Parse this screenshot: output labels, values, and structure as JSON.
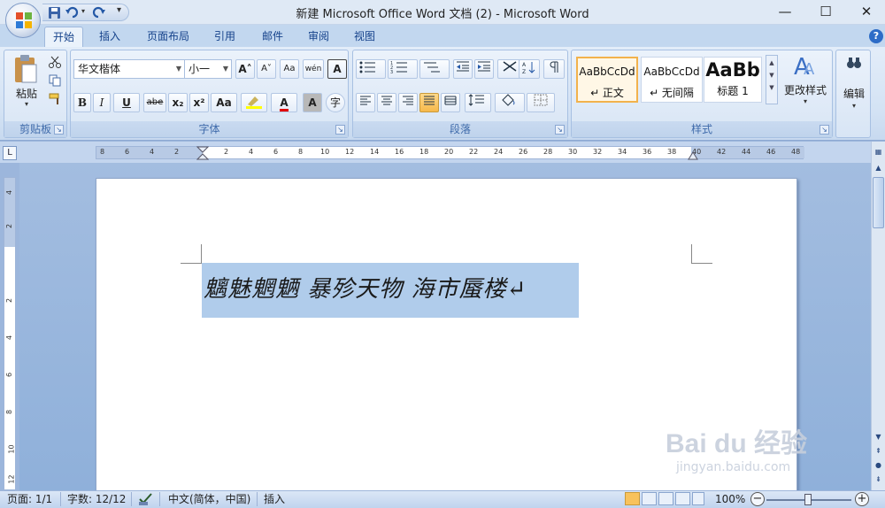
{
  "window": {
    "title": "新建 Microsoft Office Word 文档 (2) - Microsoft Word",
    "minimize": "—",
    "maximize": "☐",
    "close": "✕"
  },
  "quick_access": {
    "icons": [
      "save-icon",
      "undo-icon",
      "redo-icon",
      "customize-qat-icon"
    ]
  },
  "tabs": [
    {
      "label": "开始",
      "active": true
    },
    {
      "label": "插入"
    },
    {
      "label": "页面布局"
    },
    {
      "label": "引用"
    },
    {
      "label": "邮件"
    },
    {
      "label": "审阅"
    },
    {
      "label": "视图"
    }
  ],
  "help": "?",
  "ribbon": {
    "clipboard": {
      "label": "剪贴板",
      "paste_label": "粘贴",
      "paste_arrow": "▾"
    },
    "font": {
      "label": "字体",
      "font_name": "华文楷体",
      "font_size": "小一",
      "grow": "A˄",
      "shrink": "A˅",
      "clear": "Aa",
      "phonetic": "wén",
      "char_border": "A",
      "bold": "B",
      "italic": "I",
      "underline": "U",
      "strike": "abe",
      "subscript": "x₂",
      "superscript": "x²",
      "change_case": "Aa",
      "font_color": "A",
      "char_shading": "A",
      "enclose": "字"
    },
    "paragraph": {
      "label": "段落"
    },
    "styles": {
      "label": "样式",
      "items": [
        {
          "preview": "AaBbCcDd",
          "name": "↵ 正文"
        },
        {
          "preview": "AaBbCcDd",
          "name": "↵ 无间隔"
        },
        {
          "preview": "AaBb",
          "name": "标题 1"
        }
      ],
      "change_styles": "更改样式"
    },
    "editing": {
      "label": "编辑"
    }
  },
  "ruler": {
    "left_ticks": [
      "8",
      "6",
      "4",
      "2"
    ],
    "right_ticks": [
      "2",
      "4",
      "6",
      "8",
      "10",
      "12",
      "14",
      "16",
      "18",
      "20",
      "22",
      "24",
      "26",
      "28",
      "30",
      "32",
      "34",
      "36",
      "38",
      "40",
      "42",
      "44",
      "46",
      "48"
    ],
    "vertical_ticks": [
      "4",
      "2",
      "2",
      "4",
      "6",
      "8",
      "10",
      "12"
    ],
    "toggle": "L"
  },
  "document": {
    "text": "魑魅魍魉 暴殄天物 海市蜃楼↵"
  },
  "status": {
    "page": "页面: 1/1",
    "words": "字数: 12/12",
    "language": "中文(简体，中国)",
    "insert_mode": "插入",
    "zoom": "100%",
    "zoom_out": "−",
    "zoom_in": "+"
  },
  "watermark": {
    "brand": "Bai du 经验",
    "url": "jingyan.baidu.com"
  }
}
